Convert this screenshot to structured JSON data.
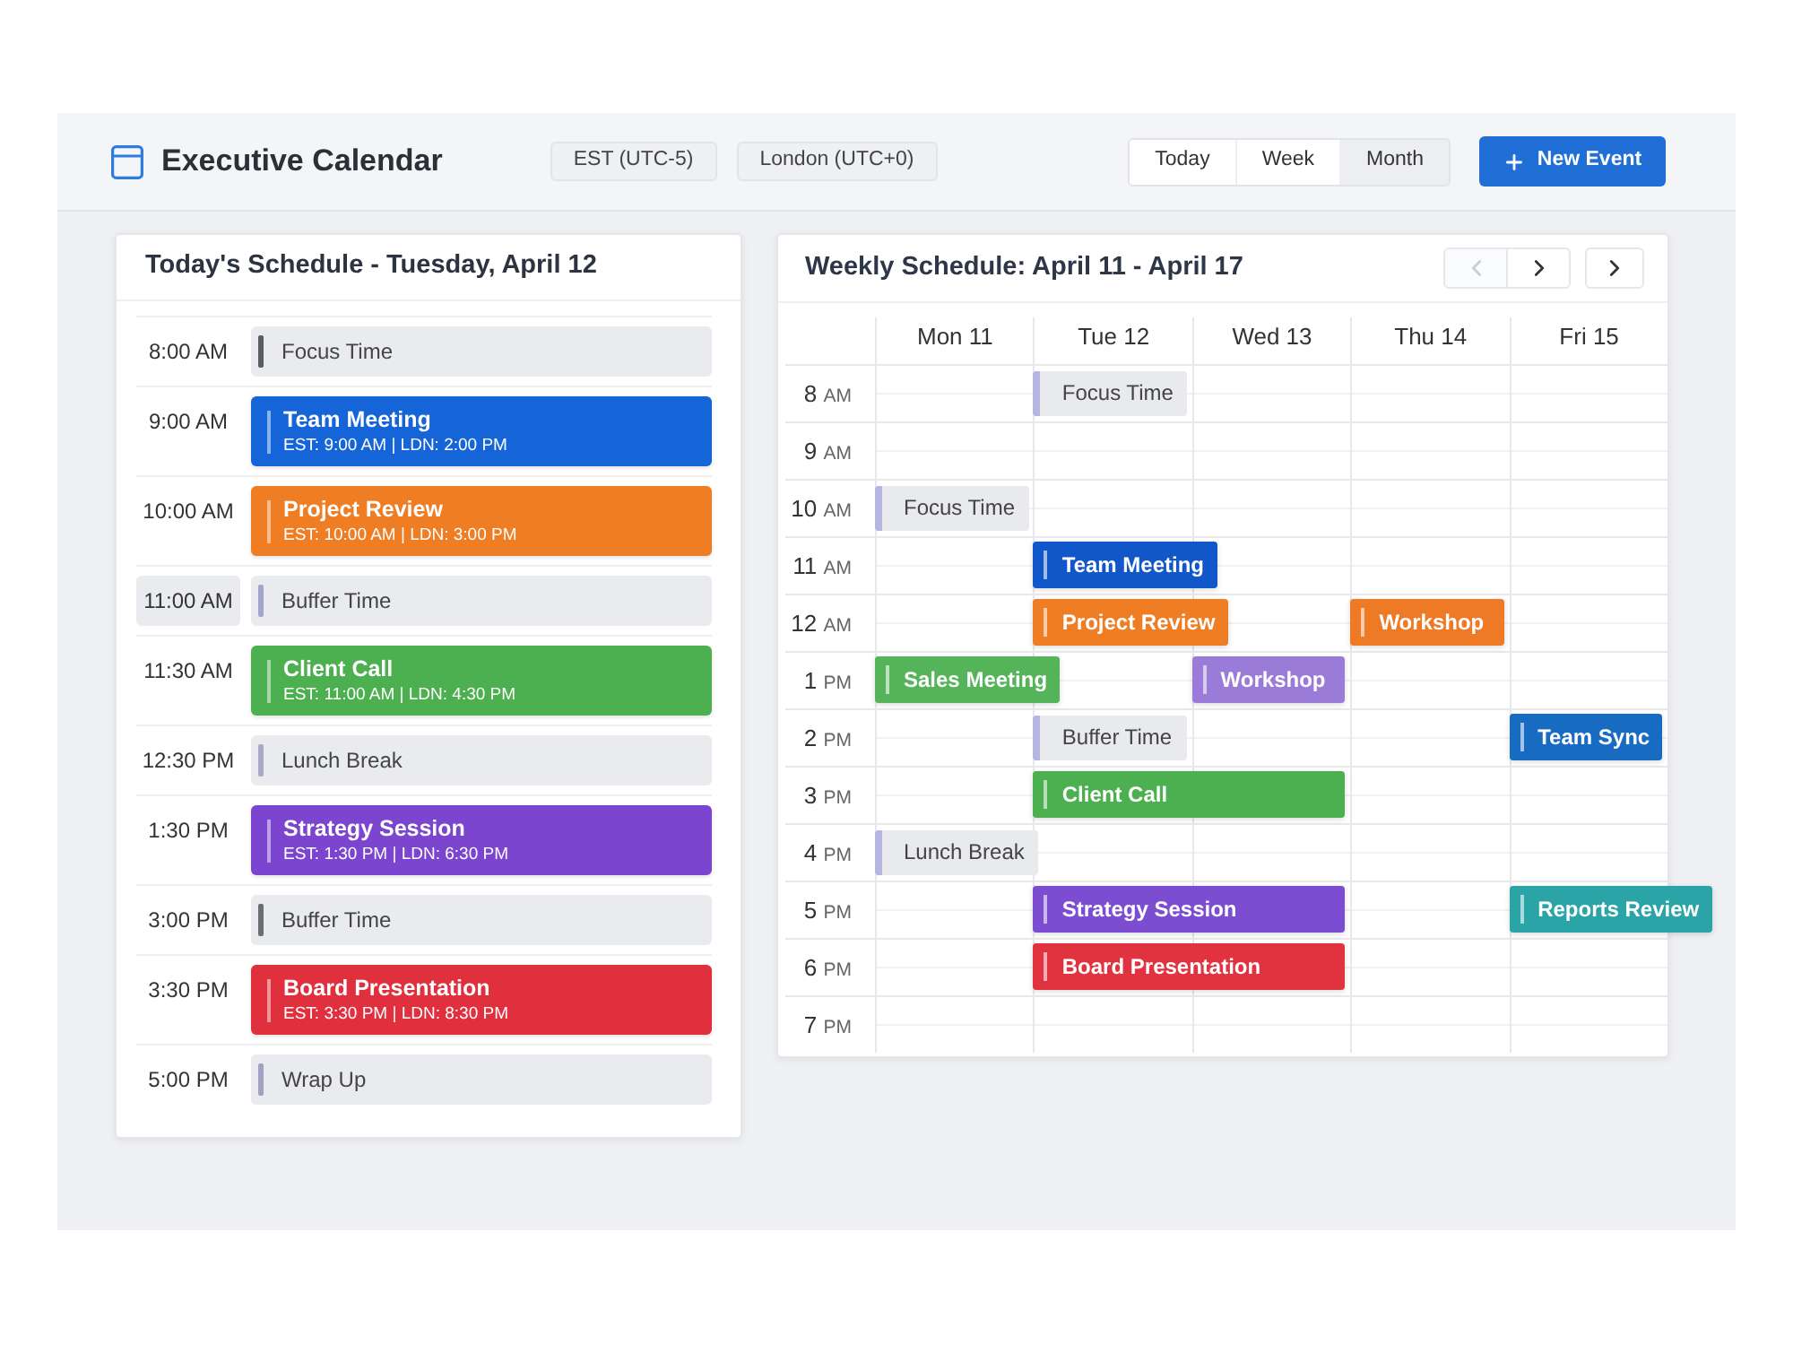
{
  "header": {
    "title": "Executive Calendar",
    "timezones": [
      "EST (UTC-5)",
      "London (UTC+0)"
    ],
    "views": [
      {
        "label": "Today",
        "selected": false
      },
      {
        "label": "Week",
        "selected": false
      },
      {
        "label": "Month",
        "selected": true
      }
    ],
    "new_event": "New Event"
  },
  "schedule": {
    "title": "Today's Schedule - Tuesday, April 12",
    "items": [
      {
        "time": "8:00 AM",
        "kind": "block",
        "title": "Focus Time",
        "color": "#5c5d61",
        "highlighted": false
      },
      {
        "time": "9:00 AM",
        "kind": "event",
        "title": "Team Meeting",
        "subtitle": "EST: 9:00 AM | LDN: 2:00 PM",
        "color": "#1565d8",
        "highlighted": false
      },
      {
        "time": "10:00 AM",
        "kind": "event",
        "title": "Project Review",
        "subtitle": "EST: 10:00 AM | LDN: 3:00 PM",
        "color": "#ef7d24",
        "highlighted": false
      },
      {
        "time": "11:00 AM",
        "kind": "block",
        "title": "Buffer Time",
        "color": "#a3a5c9",
        "highlighted": true
      },
      {
        "time": "11:30 AM",
        "kind": "event",
        "title": "Client Call",
        "subtitle": "EST: 11:00 AM | LDN: 4:30 PM",
        "color": "#4caf50",
        "highlighted": false
      },
      {
        "time": "12:30 PM",
        "kind": "block",
        "title": "Lunch Break",
        "color": "#a7a9c6",
        "highlighted": false
      },
      {
        "time": "1:30 PM",
        "kind": "event",
        "title": "Strategy Session",
        "subtitle": "EST: 1:30 PM | LDN: 6:30 PM",
        "color": "#7b45d0",
        "highlighted": false
      },
      {
        "time": "3:00 PM",
        "kind": "block",
        "title": "Buffer Time",
        "color": "#6d6e72",
        "highlighted": false
      },
      {
        "time": "3:30 PM",
        "kind": "event",
        "title": "Board Presentation",
        "subtitle": "EST: 3:30 PM | LDN: 8:30 PM",
        "color": "#e02f3d",
        "highlighted": false
      },
      {
        "time": "5:00 PM",
        "kind": "block",
        "title": "Wrap Up",
        "color": "#a0a2bf",
        "highlighted": false
      }
    ]
  },
  "week": {
    "title": "Weekly Schedule: April 11 - April 17",
    "nav": [
      {
        "kind": "prev",
        "disabled": true
      },
      {
        "kind": "next",
        "disabled": false
      },
      {
        "kind": "next",
        "disabled": false
      }
    ],
    "days": [
      "Mon 11",
      "Tue 12",
      "Wed 13",
      "Thu 14",
      "Fri 15"
    ],
    "rows": [
      {
        "hour": "8",
        "period": "AM",
        "cells": [
          {
            "kind": "empty"
          },
          {
            "kind": "block",
            "title": "Focus Time",
            "color": "#b5b6e0"
          },
          {
            "kind": "empty"
          },
          {
            "kind": "empty"
          },
          {
            "kind": "empty"
          }
        ]
      },
      {
        "hour": "9",
        "period": "AM",
        "cells": [
          {
            "kind": "empty"
          },
          {
            "kind": "empty"
          },
          {
            "kind": "empty"
          },
          {
            "kind": "empty"
          },
          {
            "kind": "empty"
          }
        ]
      },
      {
        "hour": "10",
        "period": "AM",
        "cells": [
          {
            "kind": "block",
            "title": "Focus Time",
            "color": "#b5b6e0"
          },
          {
            "kind": "empty"
          },
          {
            "kind": "empty"
          },
          {
            "kind": "empty"
          },
          {
            "kind": "empty"
          }
        ]
      },
      {
        "hour": "11",
        "period": "AM",
        "cells": [
          {
            "kind": "empty"
          },
          {
            "kind": "event",
            "title": "Team Meeting",
            "color": "#1257c9"
          },
          {
            "kind": "empty"
          },
          {
            "kind": "empty"
          },
          {
            "kind": "empty"
          }
        ]
      },
      {
        "hour": "12",
        "period": "AM",
        "cells": [
          {
            "kind": "empty"
          },
          {
            "kind": "event",
            "title": "Project Review",
            "color": "#ef7d24"
          },
          {
            "kind": "empty"
          },
          {
            "kind": "event",
            "title": "Workshop",
            "color": "#ee7a26"
          },
          {
            "kind": "empty"
          }
        ]
      },
      {
        "hour": "1",
        "period": "PM",
        "cells": [
          {
            "kind": "event",
            "title": "Sales Meeting",
            "color": "#55b35a"
          },
          {
            "kind": "empty"
          },
          {
            "kind": "event",
            "title": "Workshop",
            "color": "#9b7bd8"
          },
          {
            "kind": "empty"
          },
          {
            "kind": "empty"
          }
        ]
      },
      {
        "hour": "2",
        "period": "PM",
        "cells": [
          {
            "kind": "empty"
          },
          {
            "kind": "block",
            "title": "Buffer Time",
            "color": "#b5b6e0"
          },
          {
            "kind": "empty"
          },
          {
            "kind": "empty"
          },
          {
            "kind": "event",
            "title": "Team Sync",
            "color": "#176bc1"
          }
        ]
      },
      {
        "hour": "3",
        "period": "PM",
        "cells": [
          {
            "kind": "empty"
          },
          {
            "kind": "event",
            "title": "Client Call",
            "color": "#4caf50"
          },
          {
            "kind": "covered"
          },
          {
            "kind": "empty"
          },
          {
            "kind": "empty"
          }
        ]
      },
      {
        "hour": "4",
        "period": "PM",
        "cells": [
          {
            "kind": "block",
            "title": "Lunch Break",
            "color": "#b5b6e0"
          },
          {
            "kind": "empty"
          },
          {
            "kind": "empty"
          },
          {
            "kind": "empty"
          },
          {
            "kind": "empty"
          }
        ]
      },
      {
        "hour": "5",
        "period": "PM",
        "cells": [
          {
            "kind": "empty"
          },
          {
            "kind": "event",
            "title": "Strategy Session",
            "color": "#7c4dd0"
          },
          {
            "kind": "covered"
          },
          {
            "kind": "empty"
          },
          {
            "kind": "event",
            "title": "Reports Review",
            "color": "#2aa4a7"
          }
        ]
      },
      {
        "hour": "6",
        "period": "PM",
        "cells": [
          {
            "kind": "empty"
          },
          {
            "kind": "event",
            "title": "Board Presentation",
            "color": "#e1333f"
          },
          {
            "kind": "covered"
          },
          {
            "kind": "empty"
          },
          {
            "kind": "empty"
          }
        ]
      },
      {
        "hour": "7",
        "period": "PM",
        "cells": [
          {
            "kind": "empty"
          },
          {
            "kind": "empty"
          },
          {
            "kind": "empty"
          },
          {
            "kind": "empty"
          },
          {
            "kind": "empty"
          }
        ]
      }
    ]
  }
}
